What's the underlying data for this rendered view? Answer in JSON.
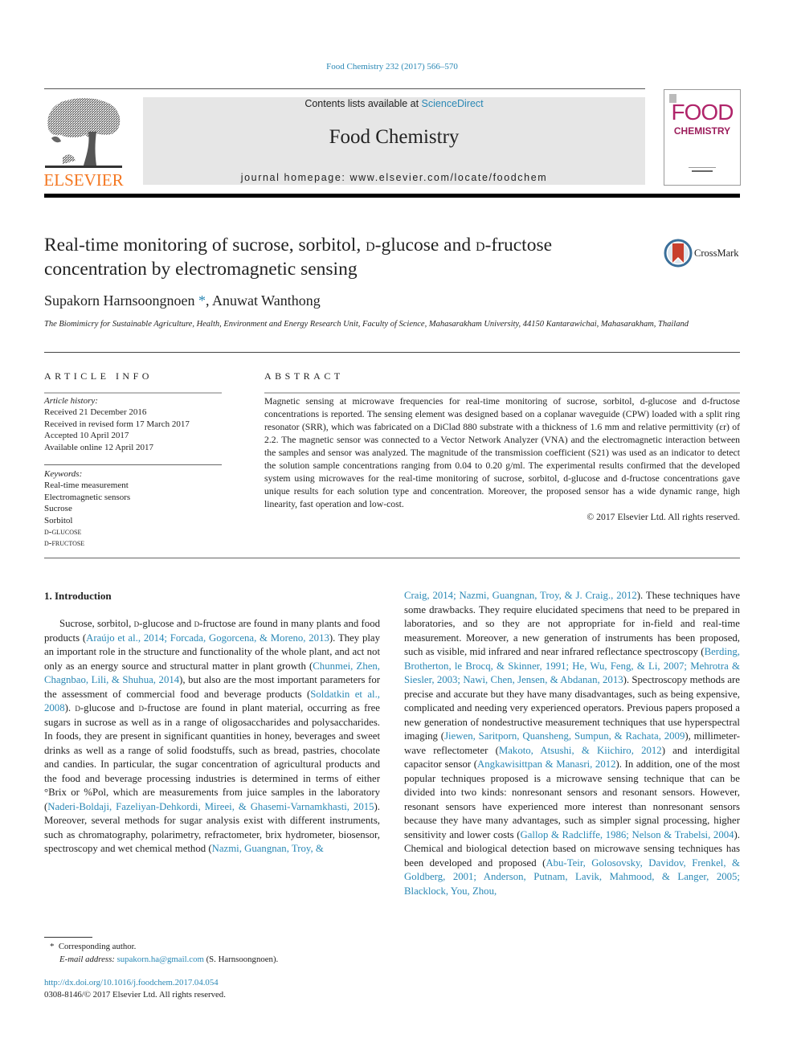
{
  "journal_ref": "Food Chemistry 232 (2017) 566–570",
  "header": {
    "publisher": "ELSEVIER",
    "contents_prefix": "Contents lists available at ",
    "contents_link": "ScienceDirect",
    "journal_title": "Food Chemistry",
    "homepage_prefix": "journal homepage: ",
    "homepage_url": "www.elsevier.com/locate/foodchem",
    "cover": {
      "line1": "FOOD",
      "line2": "CHEMISTRY"
    }
  },
  "article": {
    "title_parts": [
      "Real-time monitoring of sucrose, sorbitol, ",
      "d",
      "-glucose and ",
      "d",
      "-fructose concentration by electromagnetic sensing"
    ],
    "crossmark_label": "CrossMark",
    "authors": {
      "author1": "Supakorn Harnsoongnoen",
      "author1_mark": "*",
      "separator": ", ",
      "author2": "Anuwat Wanthong"
    },
    "affiliation": "The Biomimicry for Sustainable Agriculture, Health, Environment and Energy Research Unit, Faculty of Science, Mahasarakham University, 44150 Kantarawichai, Mahasarakham, Thailand"
  },
  "article_info": {
    "label": "ARTICLE INFO",
    "history_heading": "Article history:",
    "history": [
      "Received 21 December 2016",
      "Received in revised form 17 March 2017",
      "Accepted 10 April 2017",
      "Available online 12 April 2017"
    ],
    "keywords_heading": "Keywords:",
    "keywords": [
      "Real-time measurement",
      "Electromagnetic sensors",
      "Sucrose",
      "Sorbitol",
      "d-glucose",
      "d-fructose"
    ]
  },
  "abstract": {
    "label": "ABSTRACT",
    "text": "Magnetic sensing at microwave frequencies for real-time monitoring of sucrose, sorbitol, d-glucose and d-fructose concentrations is reported. The sensing element was designed based on a coplanar waveguide (CPW) loaded with a split ring resonator (SRR), which was fabricated on a DiClad 880 substrate with a thickness of 1.6 mm and relative permittivity (εr) of 2.2. The magnetic sensor was connected to a Vector Network Analyzer (VNA) and the electromagnetic interaction between the samples and sensor was analyzed. The magnitude of the transmission coefficient (S21) was used as an indicator to detect the solution sample concentrations ranging from 0.04 to 0.20 g/ml. The experimental results confirmed that the developed system using microwaves for the real-time monitoring of sucrose, sorbitol, d-glucose and d-fructose concentrations gave unique results for each solution type and concentration. Moreover, the proposed sensor has a wide dynamic range, high linearity, fast operation and low-cost.",
    "copyright": "© 2017 Elsevier Ltd. All rights reserved."
  },
  "body": {
    "section_heading": "1. Introduction",
    "left_column": [
      {
        "t": "Sucrose, sorbitol, "
      },
      {
        "t": "d",
        "sc": true
      },
      {
        "t": "-glucose and "
      },
      {
        "t": "d",
        "sc": true
      },
      {
        "t": "-fructose are found in many plants and food products ("
      },
      {
        "t": "Araújo et al., 2014; Forcada, Gogorcena, & Moreno, 2013",
        "link": true
      },
      {
        "t": "). They play an important role in the structure and functionality of the whole plant, and act not only as an energy source and structural matter in plant growth ("
      },
      {
        "t": "Chunmei, Zhen, Chagnbao, Lili, & Shuhua, 2014",
        "link": true
      },
      {
        "t": "), but also are the most important parameters for the assessment of commercial food and beverage products ("
      },
      {
        "t": "Soldatkin et al., 2008",
        "link": true
      },
      {
        "t": "). "
      },
      {
        "t": "d",
        "sc": true
      },
      {
        "t": "-glucose and "
      },
      {
        "t": "d",
        "sc": true
      },
      {
        "t": "-fructose are found in plant material, occurring as free sugars in sucrose as well as in a range of oligosaccharides and polysaccharides. In foods, they are present in significant quantities in honey, beverages and sweet drinks as well as a range of solid foodstuffs, such as bread, pastries, chocolate and candies. In particular, the sugar concentration of agricultural products and the food and beverage processing industries is determined in terms of either °Brix or %Pol, which are measurements from juice samples in the laboratory ("
      },
      {
        "t": "Naderi-Boldaji, Fazeliyan-Dehkordi, Mireei, & Ghasemi-Varnamkhasti, 2015",
        "link": true
      },
      {
        "t": "). Moreover, several methods for sugar analysis exist with different instruments, such as chromatography, polarimetry, refractometer, brix hydrometer, biosensor, spectroscopy and wet chemical method ("
      },
      {
        "t": "Nazmi, Guangnan, Troy, &",
        "link": true
      }
    ],
    "right_column": [
      {
        "t": "Craig, 2014; Nazmi, Guangnan, Troy, & J. Craig., 2012",
        "link": true
      },
      {
        "t": "). These techniques have some drawbacks. They require elucidated specimens that need to be prepared in laboratories, and so they are not appropriate for in-field and real-time measurement. Moreover, a new generation of instruments has been proposed, such as visible, mid infrared and near infrared reflectance spectroscopy ("
      },
      {
        "t": "Berding, Brotherton, le Brocq, & Skinner, 1991; He, Wu, Feng, & Li, 2007; Mehrotra & Siesler, 2003; Nawi, Chen, Jensen, & Abdanan, 2013",
        "link": true
      },
      {
        "t": "). Spectroscopy methods are precise and accurate but they have many disadvantages, such as being expensive, complicated and needing very experienced operators. Previous papers proposed a new generation of nondestructive measurement techniques that use hyperspectral imaging ("
      },
      {
        "t": "Jiewen, Saritporn, Quansheng, Sumpun, & Rachata, 2009",
        "link": true
      },
      {
        "t": "), millimeter-wave reflectometer ("
      },
      {
        "t": "Makoto, Atsushi, & Kiichiro, 2012",
        "link": true
      },
      {
        "t": ") and interdigital capacitor sensor ("
      },
      {
        "t": "Angkawisittpan & Manasri, 2012",
        "link": true
      },
      {
        "t": "). In addition, one of the most popular techniques proposed is a microwave sensing technique that can be divided into two kinds: nonresonant sensors and resonant sensors. However, resonant sensors have experienced more interest than nonresonant sensors because they have many advantages, such as simpler signal processing, higher sensitivity and lower costs ("
      },
      {
        "t": "Gallop & Radcliffe, 1986; Nelson & Trabelsi, 2004",
        "link": true
      },
      {
        "t": "). Chemical and biological detection based on microwave sensing techniques has been developed and proposed ("
      },
      {
        "t": "Abu-Teir, Golosovsky, Davidov, Frenkel, & Goldberg, 2001; Anderson, Putnam, Lavik, Mahmood, & Langer, 2005; Blacklock, You, Zhou,",
        "link": true
      }
    ]
  },
  "footnotes": {
    "mark": "*",
    "corresponding": "Corresponding author.",
    "email_label": "E-mail address: ",
    "email": "supakorn.ha@gmail.com",
    "email_suffix": " (S. Harnsoongnoen)."
  },
  "doi": {
    "url": "http://dx.doi.org/10.1016/j.foodchem.2017.04.054",
    "issn_line": "0308-8146/© 2017 Elsevier Ltd. All rights reserved."
  }
}
